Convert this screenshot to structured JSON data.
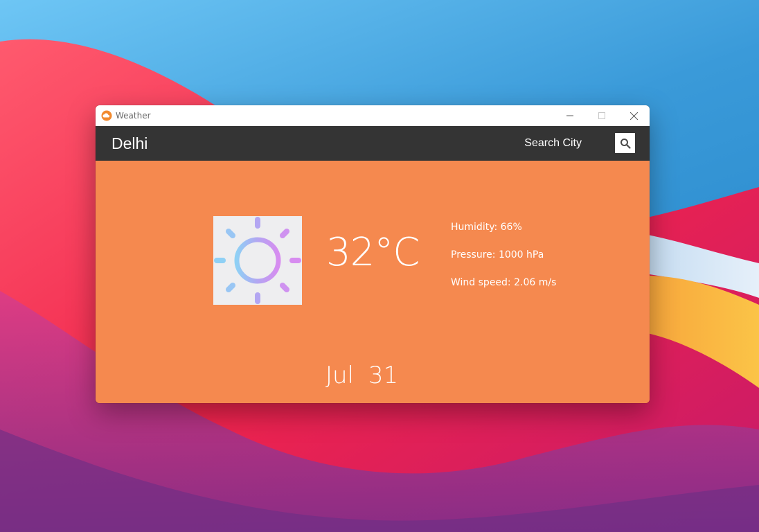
{
  "window": {
    "title": "Weather",
    "app_icon": "cloud-sun-icon"
  },
  "header": {
    "city": "Delhi",
    "search_label": "Search City",
    "search_icon": "search-icon"
  },
  "weather": {
    "condition_icon": "sun-icon",
    "temperature": "32°C",
    "humidity": "Humidity: 66%",
    "pressure": "Pressure: 1000 hPa",
    "wind_speed": "Wind speed: 2.06 m/s",
    "date": "Jul 31"
  },
  "colors": {
    "accent": "#f5894f",
    "header_bg": "#343434",
    "icon_bg": "#eeeef0"
  }
}
